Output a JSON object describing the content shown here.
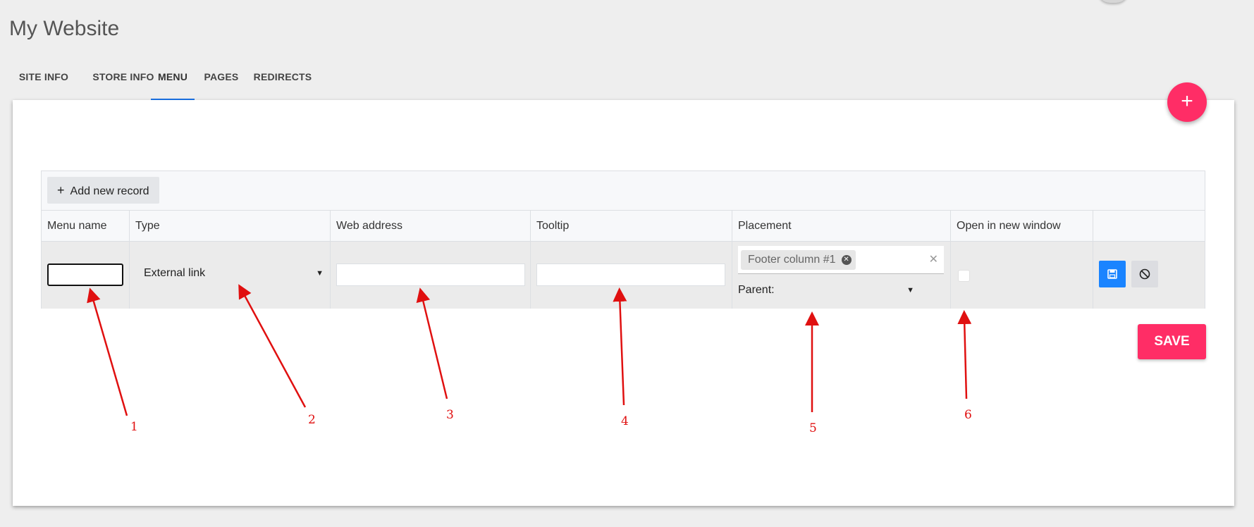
{
  "site": {
    "title": "My Website"
  },
  "tabs": [
    {
      "label": "SITE INFO",
      "active": false
    },
    {
      "label": "STORE INFO",
      "active": false
    },
    {
      "label": "MENU",
      "active": true
    },
    {
      "label": "PAGES",
      "active": false
    },
    {
      "label": "REDIRECTS",
      "active": false
    }
  ],
  "fab": {
    "label": "+"
  },
  "grid": {
    "add_button": {
      "icon": "plus-icon",
      "label": "Add new record"
    },
    "columns": [
      "Menu name",
      "Type",
      "Web address",
      "Tooltip",
      "Placement",
      "Open in new window",
      ""
    ],
    "row": {
      "menu_name": "",
      "type": {
        "value": "External link",
        "icon": "caret-down-icon"
      },
      "web_address": "",
      "tooltip": "",
      "placement": {
        "tags": [
          "Footer column #1"
        ],
        "tag_remove_icon": "close-circle-icon",
        "clear_icon": "clear-icon",
        "parent_label": "Parent:"
      },
      "open_in_new_window": false,
      "actions": {
        "save_icon": "floppy-disk-icon",
        "cancel_icon": "cancel-icon"
      }
    }
  },
  "save_button": {
    "label": "SAVE"
  },
  "annotations": [
    "1",
    "2",
    "3",
    "4",
    "5",
    "6"
  ],
  "colors": {
    "accent": "#ff2d66",
    "tab_indicator": "#1a73e8",
    "primary_blue": "#1a84ff",
    "annotation_red": "#e01010"
  }
}
